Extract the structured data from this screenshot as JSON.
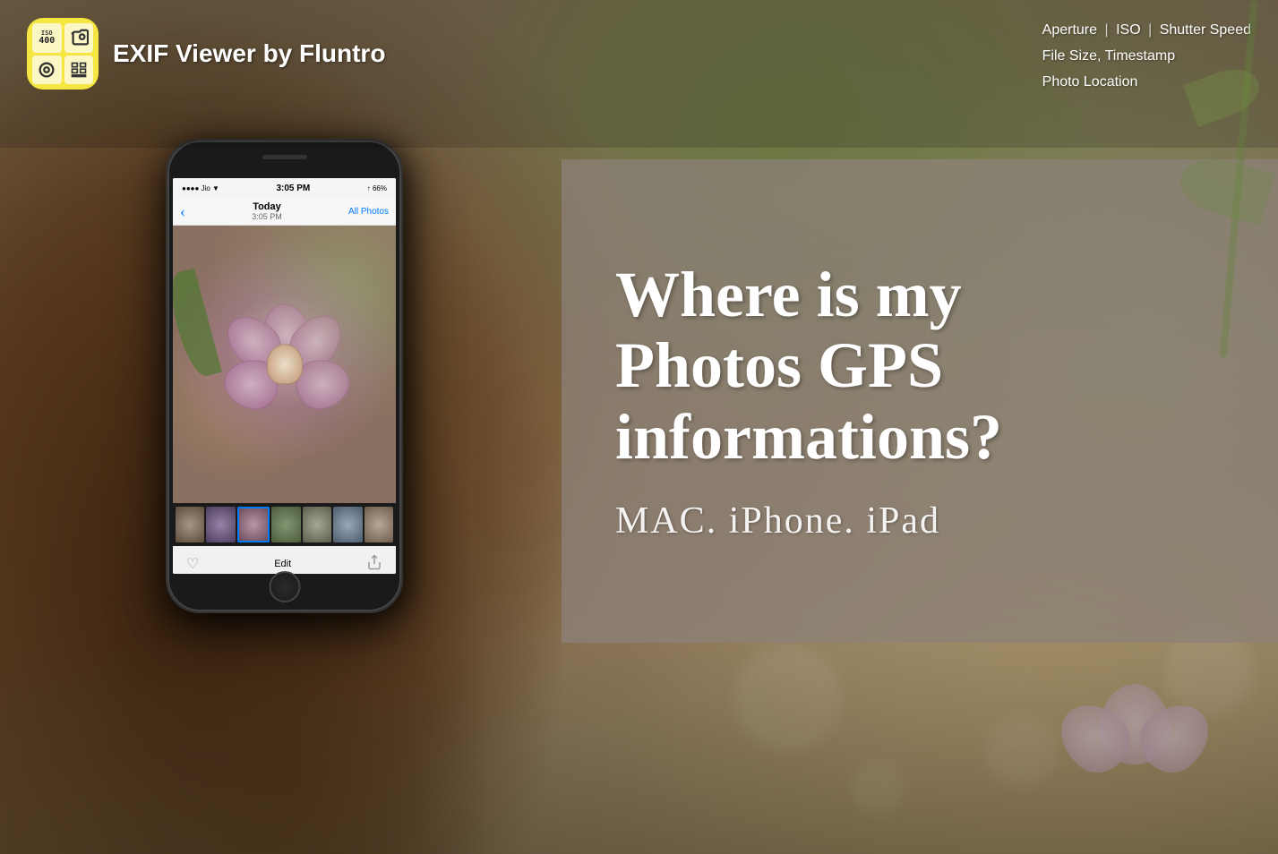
{
  "app": {
    "icon_label": "EXIF App Icon",
    "name": "EXIF Viewer by Fluntro"
  },
  "header": {
    "features_line1": "Aperture | ISO | Shutter Speed",
    "features_line2": "File Size, Timestamp",
    "features_line3": "Photo Location",
    "feature1": "Aperture",
    "divider1": "|",
    "feature2": "ISO",
    "divider2": "|",
    "feature3": "Shutter Speed",
    "feature4": "File Size, Timestamp",
    "feature5": "Photo Location"
  },
  "phone": {
    "status_time": "3:05 PM",
    "status_signal": "↑ 66%",
    "nav_today": "Today",
    "nav_date": "3:05 PM",
    "nav_all_photos": "All Photos",
    "edit_label": "Edit",
    "heart_icon": "♡",
    "share_icon": "⬆"
  },
  "main_content": {
    "heading_line1": "Where is my",
    "heading_line2": "Photos GPS",
    "heading_line3": "informations?",
    "subheading": "MAC.  iPhone.  iPad"
  }
}
